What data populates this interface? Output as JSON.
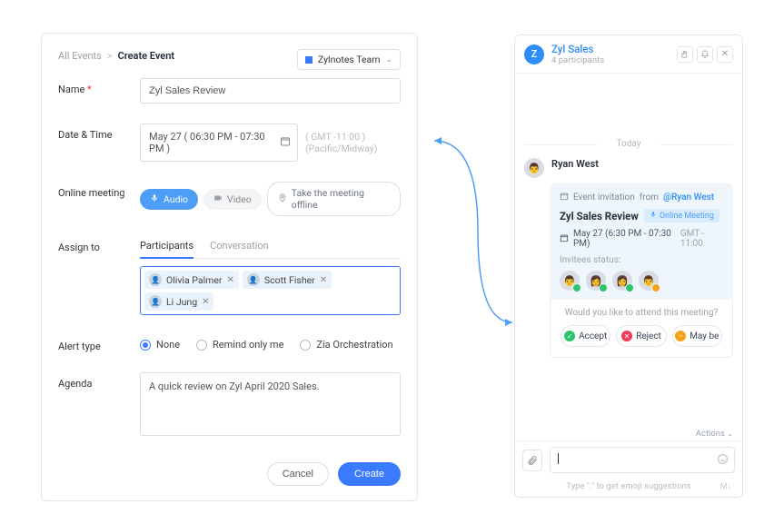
{
  "breadcrumb": {
    "all": "All Events",
    "sep": ">",
    "current": "Create Event"
  },
  "team_selector": {
    "label": "Zylnotes Team"
  },
  "form": {
    "name_label": "Name",
    "name_value": "Zyl Sales Review",
    "datetime_label": "Date & Time",
    "datetime_value": "May 27  ( 06:30 PM - 07:30 PM )",
    "timezone": "( GMT -11:00 )  (Pacific/Midway)",
    "meeting_label": "Online meeting",
    "audio_label": "Audio",
    "video_label": "Video",
    "offline_label": "Take the meeting offline",
    "assign_label": "Assign to",
    "tab_participants": "Participants",
    "tab_conversation": "Conversation",
    "chips": [
      "Olivia Palmer",
      "Scott Fisher",
      "Li Jung"
    ],
    "alert_label": "Alert type",
    "alert_none": "None",
    "alert_remind": "Remind only me",
    "alert_zia": "Zia Orchestration",
    "agenda_label": "Agenda",
    "agenda_value": "A quick review on Zyl April 2020 Sales.",
    "cancel": "Cancel",
    "create": "Create"
  },
  "chat": {
    "header_title": "Zyl Sales",
    "header_sub": "4 participants",
    "avatar_letter": "Z",
    "today": "Today",
    "sender": "Ryan West",
    "card": {
      "invite_prefix": "Event invitation",
      "invite_from": "from",
      "invite_user": "@Ryan West",
      "title": "Zyl Sales Review",
      "online_meeting": "Online Meeting",
      "dt_range": "May 27 (6:30 PM  -  07:30 PM)",
      "tz": "GMT - 11:00",
      "invitees_label": "Invitees status:",
      "attend_q": "Would you like to attend this meeting?",
      "accept": "Accept",
      "reject": "Reject",
      "maybe": "May be"
    },
    "actions": "Actions",
    "hint": "Type \":\" to get emoji suggestions",
    "md": "M↓"
  }
}
